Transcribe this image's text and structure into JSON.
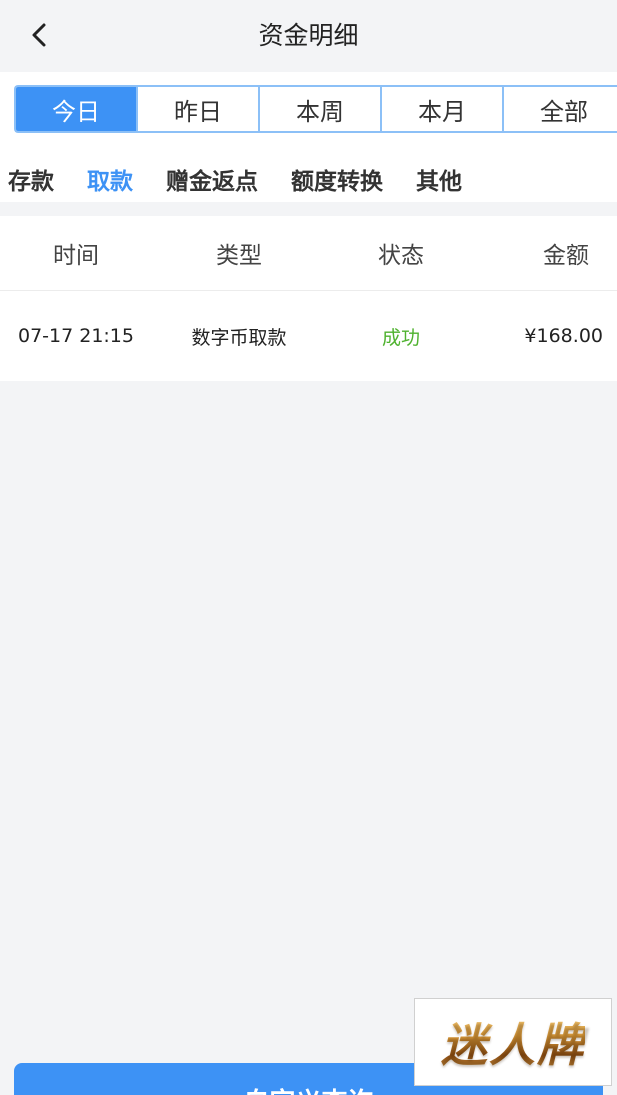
{
  "header": {
    "title": "资金明细",
    "back_icon": "chevron-left-icon"
  },
  "period_tabs": [
    {
      "label": "今日",
      "active": true
    },
    {
      "label": "昨日",
      "active": false
    },
    {
      "label": "本周",
      "active": false
    },
    {
      "label": "本月",
      "active": false
    },
    {
      "label": "全部",
      "active": false
    }
  ],
  "category_tabs": [
    {
      "label": "存款",
      "active": false
    },
    {
      "label": "取款",
      "active": true
    },
    {
      "label": "赠金返点",
      "active": false
    },
    {
      "label": "额度转换",
      "active": false
    },
    {
      "label": "其他",
      "active": false
    }
  ],
  "table": {
    "columns": [
      "时间",
      "类型",
      "状态",
      "金额"
    ],
    "rows": [
      {
        "time": "07-17 21:15",
        "type": "数字币取款",
        "status": "成功",
        "amount": "¥168.00"
      }
    ]
  },
  "bottom_button": {
    "label": "自定义查询"
  },
  "watermark": {
    "text": "迷人牌"
  },
  "colors": {
    "accent": "#3d92f5",
    "success": "#4fb22f",
    "background": "#f3f4f6"
  }
}
